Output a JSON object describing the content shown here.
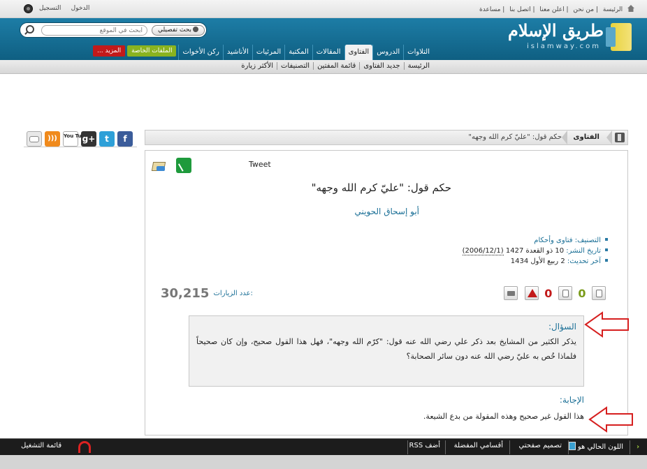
{
  "topbar": {
    "links": [
      "الرئيسة",
      "من نحن",
      "اعلن معنا",
      "اتصل بنا",
      "مساعدة"
    ],
    "login": "الدخول",
    "register": "التسجيل"
  },
  "header": {
    "logo_ar": "طريق الإسلام",
    "logo_en": "islamway.com",
    "search_placeholder": "ابحث في الموقع",
    "advanced_search": "بحث تفصيلي"
  },
  "nav": {
    "tabs": [
      "التلاوات",
      "الدروس",
      "الفتاوى",
      "المقالات",
      "المكتبة",
      "المرئيات",
      "الأناشيد",
      "ركن الأخوات"
    ],
    "special_files": "الملفات الخاصة",
    "more": "المزيد ..."
  },
  "subnav": [
    "الرئيسة",
    "جديد الفتاوى",
    "قائمة المفتين",
    "التصنيفات",
    "الأكثر زيارة"
  ],
  "social": {
    "facebook": "f",
    "twitter": "t",
    "googleplus": "g+",
    "youtube": "You Tube"
  },
  "breadcrumb": {
    "section": "الفتاوى",
    "current": "حكم قول: \"عليّ كرم الله وجهه\""
  },
  "article": {
    "tweet": "Tweet",
    "title": "حكم قول: \"عليّ كرم الله وجهه\"",
    "author": "أبو إسحاق الحويني",
    "meta": {
      "category_label": "التصنيف:",
      "category": "فتاوى وأحكام",
      "published_label": "تاريخ النشر:",
      "published": "10 ذو القعدة 1427",
      "published_greg": "(2006/12/1)",
      "updated_label": "آخر تحديث:",
      "updated": "2 ربيع الأول 1434"
    },
    "visits_label": "عدد الزيارات:",
    "visits": "30,215",
    "likes": "0",
    "dislikes": "0",
    "question_label": "السؤال:",
    "question": "يذكر الكثير من المشايخ بعد ذكر علي رضي الله عنه قول: \"كرّم الله وجهه\"، فهل هذا القول صحيح، وإن كان صحيحاً فلماذا خُص به عليّ رضي الله عنه دون سائر الصحابة؟",
    "answer_label": "الإجابة:",
    "answer": "هذا القول غير صحيح وهذه المقولة من بدع الشيعة."
  },
  "bottombar": {
    "color_label": "اللون الحالي هو",
    "design": "تصميم صفحتي",
    "favorites": "أقسامي المفضلة",
    "rss": "أضف RSS",
    "playlist": "قائمة التشغيل"
  },
  "colors": {
    "header": "#1a7399",
    "link": "#1a6f96",
    "arrow": "#d61f1f"
  }
}
